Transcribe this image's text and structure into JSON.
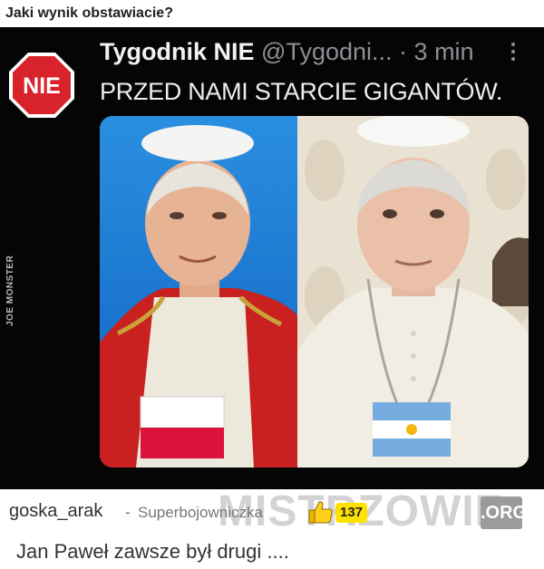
{
  "post": {
    "title": "Jaki wynik obstawiacie?"
  },
  "image": {
    "side_watermark": "JOE MONSTER",
    "logo_text": "NIE",
    "tweet": {
      "name": "Tygodnik NIE",
      "handle": "@Tygodni...",
      "dot": "·",
      "time": "3 min",
      "text": "PRZED NAMI STARCIE GIGANTÓW."
    },
    "flags": {
      "left": "poland-flag",
      "right": "argentina-flag"
    }
  },
  "comment": {
    "user": "goska_arak",
    "separator": "-",
    "rank": "Superbojowniczka",
    "score": "137",
    "text": "Jan Paweł zawsze był drugi ....",
    "site_watermark": "MISTRZOWIE",
    "site_watermark_org": ".ORG"
  },
  "colors": {
    "logo_red": "#d9232a",
    "score_yellow": "#ffe100",
    "poland_red": "#dc143c",
    "argentina_blue": "#74acdf"
  }
}
